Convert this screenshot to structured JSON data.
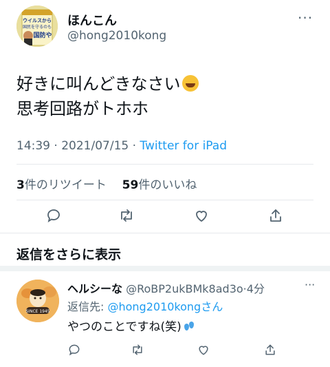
{
  "tweet": {
    "user": {
      "name": "ほんこん",
      "handle": "@hong2010kong"
    },
    "avatar_book_title": "ウイルスから国民を守るのも国防や",
    "text_line1": "好きに叫んどきなさい",
    "text_line2": "思考回路がトホホ",
    "emoji": "rolling-on-floor-laughing",
    "time": "14:39",
    "sep": "·",
    "date": "2021/07/15",
    "source": "Twitter for iPad",
    "retweets_count": "3",
    "retweets_label": "件のリツイート",
    "likes_count": "59",
    "likes_label": "件のいいね",
    "more_glyph": "···"
  },
  "show_more_replies": "返信をさらに表示",
  "reply": {
    "name": "ヘルシーな",
    "handle": "@RoBP2ukBMk8ad3o",
    "sep": "·",
    "time": "4分",
    "replying_prefix": "返信先: ",
    "replying_handle": "@hong2010kong",
    "replying_suffix": "さん",
    "avatar_badge": "SINCE 1945",
    "text": "やつのことですね(笑)",
    "emoji": "sweat-droplets",
    "more_glyph": "···"
  },
  "colors": {
    "link": "#1d9bf0",
    "secondary": "#536471",
    "divider": "#e6e9ec",
    "band": "#eff3f4"
  }
}
